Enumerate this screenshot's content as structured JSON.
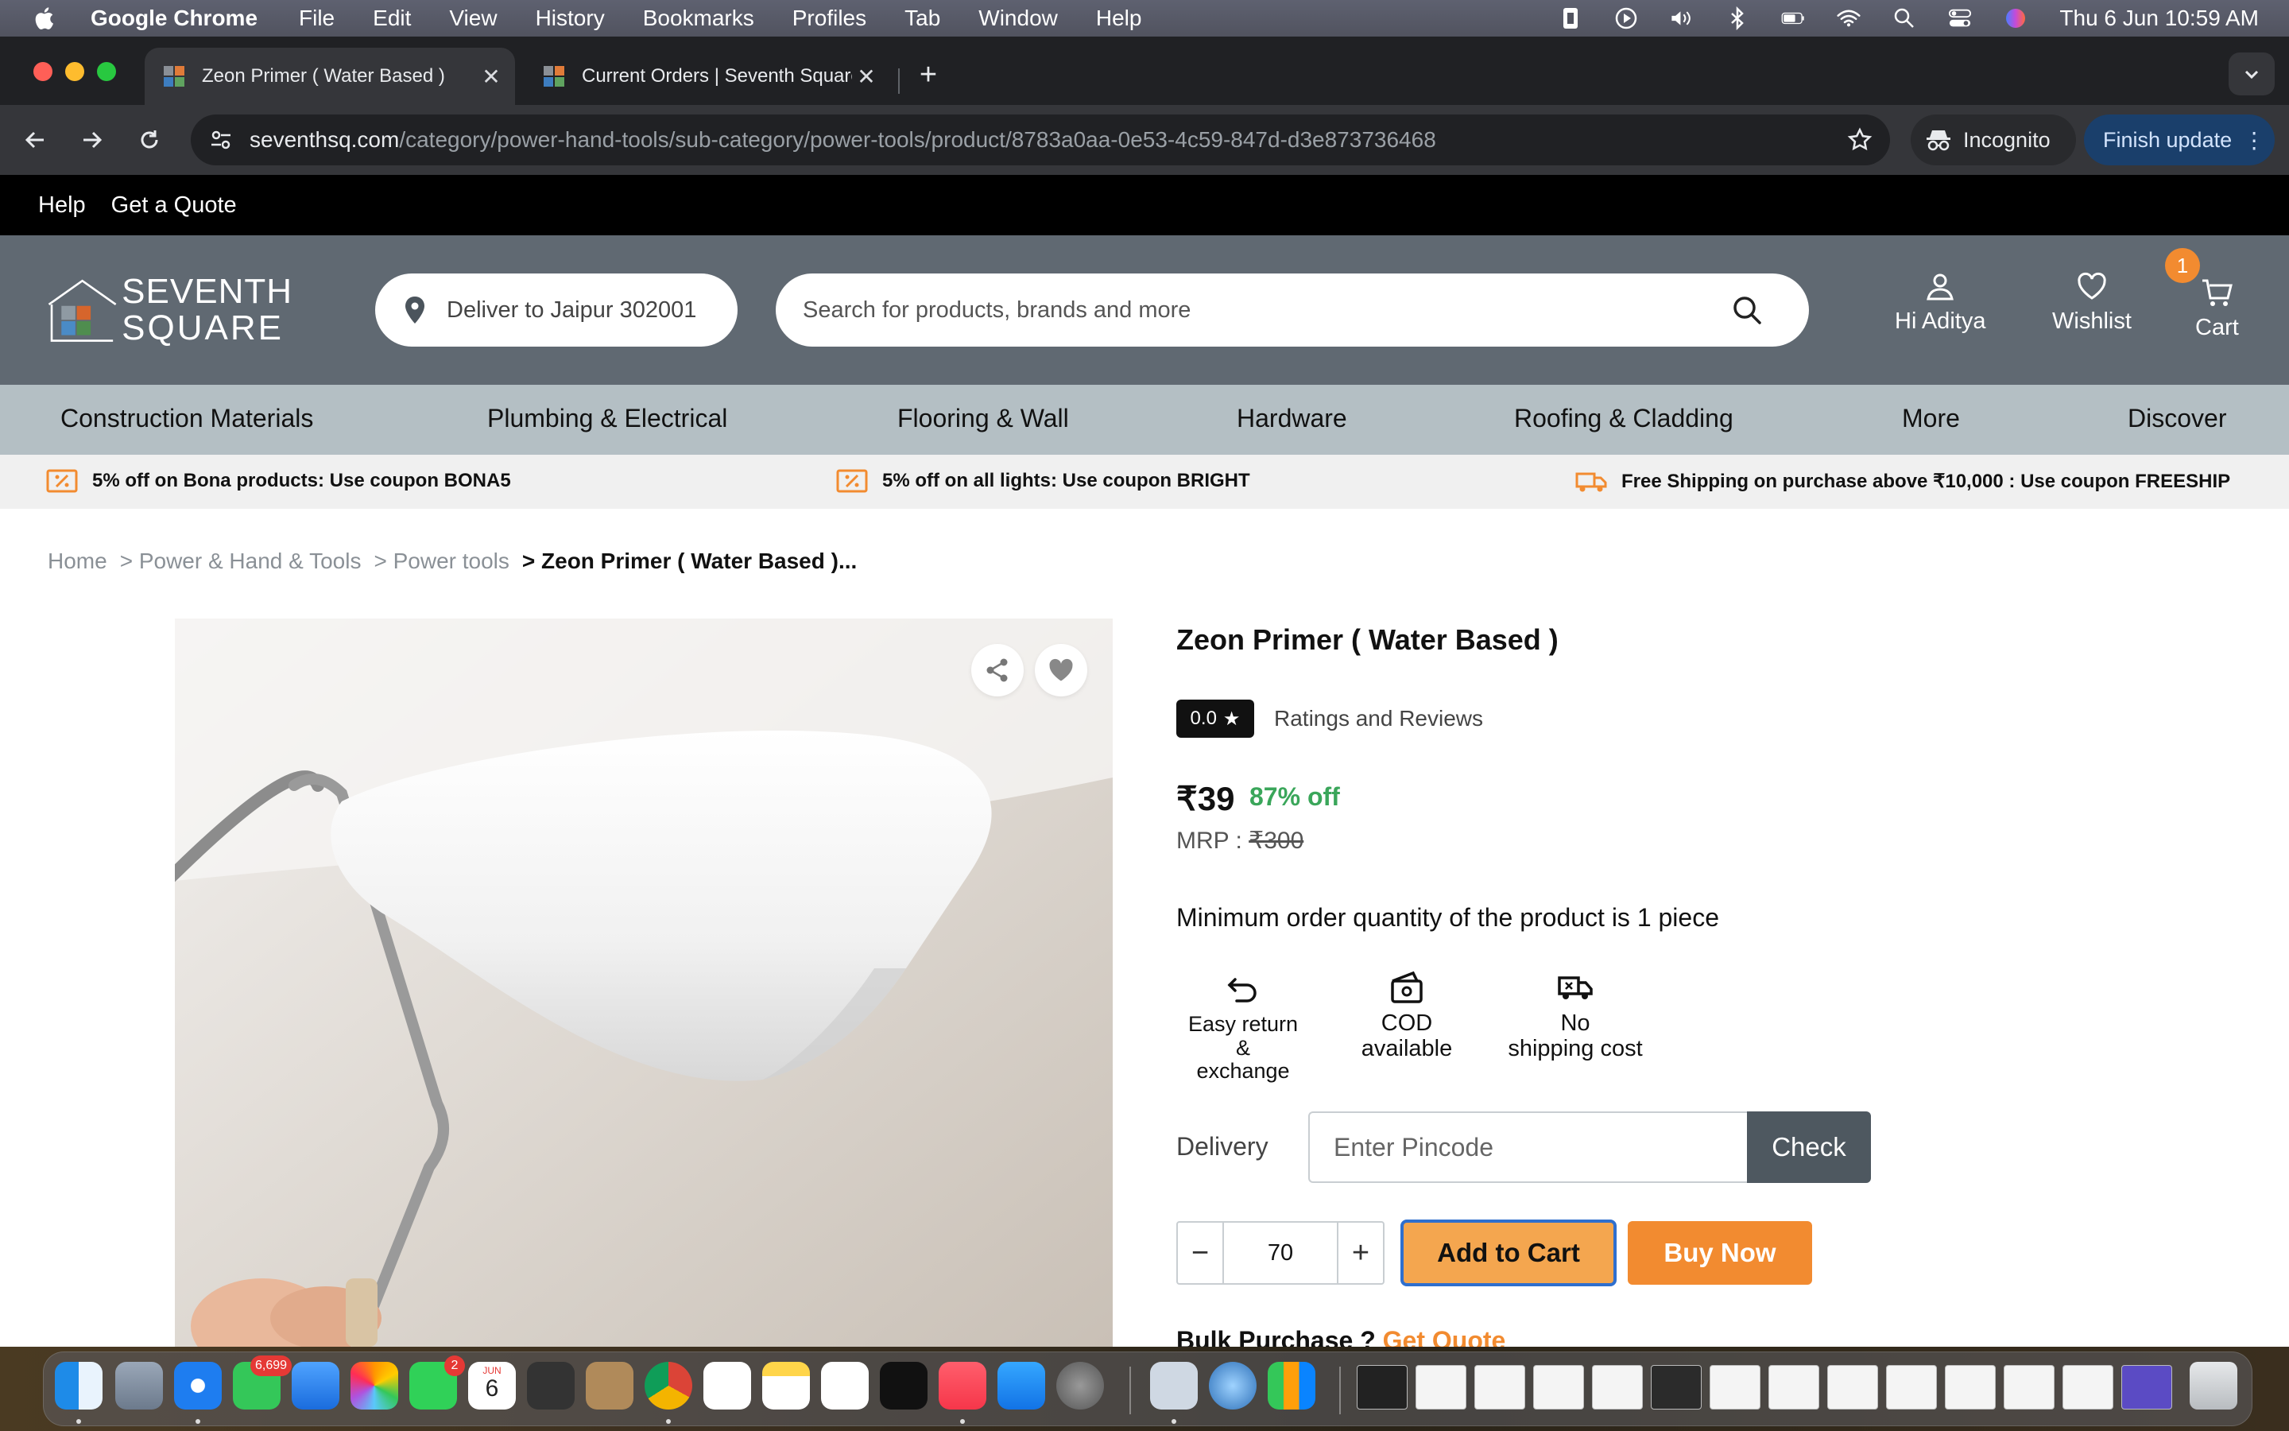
{
  "menubar": {
    "app_name": "Google Chrome",
    "items": [
      "File",
      "Edit",
      "View",
      "History",
      "Bookmarks",
      "Profiles",
      "Tab",
      "Window",
      "Help"
    ],
    "clock": "Thu 6 Jun  10:59 AM"
  },
  "browser": {
    "tabs": [
      {
        "title": "Zeon Primer ( Water Based )",
        "active": true
      },
      {
        "title": "Current Orders | Seventh Square",
        "active": false
      }
    ],
    "url_host": "seventhsq.com",
    "url_path": "/category/power-hand-tools/sub-category/power-tools/product/8783a0aa-0e53-4c59-847d-d3e873736468",
    "incognito_label": "Incognito",
    "update_label": "Finish update"
  },
  "topstrip": {
    "help": "Help",
    "quote": "Get a Quote"
  },
  "header": {
    "logo_line1": "SEVENTH",
    "logo_line2": "SQUARE",
    "deliver_to": "Deliver to Jaipur 302001",
    "search_placeholder": "Search for products, brands and more",
    "account_label": "Hi Aditya",
    "wishlist_label": "Wishlist",
    "cart_label": "Cart",
    "cart_count": "1"
  },
  "categories": [
    "Construction Materials",
    "Plumbing & Electrical",
    "Flooring & Wall",
    "Hardware",
    "Roofing & Cladding",
    "More",
    "Discover"
  ],
  "offers": [
    "5% off on Bona products: Use coupon BONA5",
    "5% off on all lights: Use coupon BRIGHT",
    "Free Shipping on purchase above ₹10,000 : Use coupon FREESHIP"
  ],
  "breadcrumb": [
    "Home",
    "> Power & Hand & Tools",
    "> Power tools",
    "> Zeon Primer ( Water Based )..."
  ],
  "product": {
    "title": "Zeon Primer ( Water Based )",
    "rating": "0.0",
    "ratings_label": "Ratings and Reviews",
    "price": "₹39",
    "discount": "87% off",
    "mrp_label": "MRP : ",
    "mrp_value": "₹300",
    "moq_text": "Minimum order quantity of the product is 1 piece",
    "features": [
      {
        "icon": "return-icon",
        "line1": "Easy return &",
        "line2": "exchange"
      },
      {
        "icon": "cod-icon",
        "line1": "COD",
        "line2": "available"
      },
      {
        "icon": "truck-icon",
        "line1": "No",
        "line2": "shipping cost"
      }
    ],
    "delivery_label": "Delivery",
    "pincode_placeholder": "Enter Pincode",
    "check_label": "Check",
    "quantity": "70",
    "add_to_cart_label": "Add to Cart",
    "buy_now_label": "Buy Now",
    "bulk_label": "Bulk Purchase ? ",
    "bulk_link": "Get Quote"
  },
  "dock": {
    "messages_badge": "6,699",
    "facetime_badge": "2",
    "calendar_month": "JUN",
    "calendar_day": "6"
  },
  "colors": {
    "accent_orange": "#f28b30",
    "header_grey": "#606972",
    "nav_grey": "#b4bfc4",
    "discount_green": "#3aa65a"
  }
}
